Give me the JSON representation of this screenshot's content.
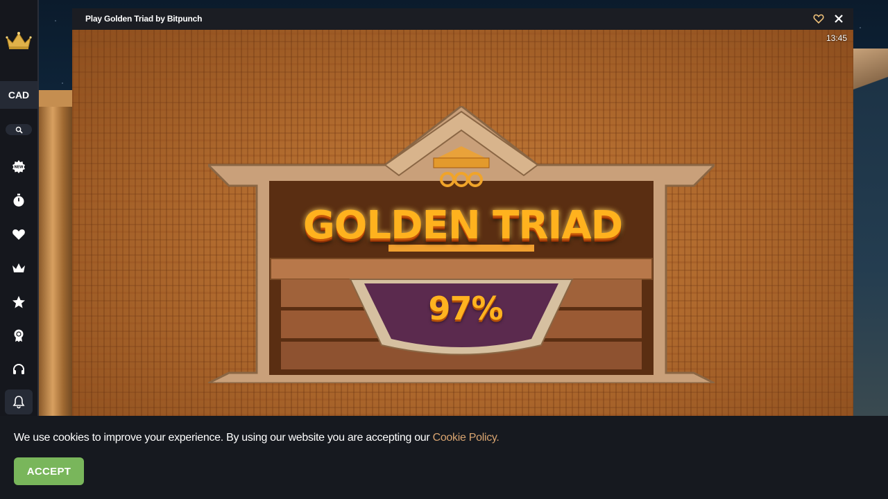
{
  "sidebar": {
    "currency": "CAD",
    "items": [
      {
        "icon": "new-badge-icon"
      },
      {
        "icon": "stopwatch-icon"
      },
      {
        "icon": "heart-icon"
      },
      {
        "icon": "crown-icon"
      },
      {
        "icon": "star-icon"
      },
      {
        "icon": "trophy-icon"
      },
      {
        "icon": "headset-icon"
      },
      {
        "icon": "bell-icon"
      }
    ]
  },
  "game_window": {
    "title": "Play Golden Triad by Bitpunch",
    "time": "13:45",
    "game": {
      "headline": "GOLDEN TRIAD",
      "rtp": "97%"
    }
  },
  "cookie_banner": {
    "text": "We use cookies to improve your experience. By using our website you are accepting our ",
    "link_text": "Cookie Policy.",
    "accept_label": "ACCEPT"
  },
  "colors": {
    "accent_gold": "#d8a470",
    "accept_green": "#79b65b",
    "sidebar_bg": "#15171d"
  }
}
